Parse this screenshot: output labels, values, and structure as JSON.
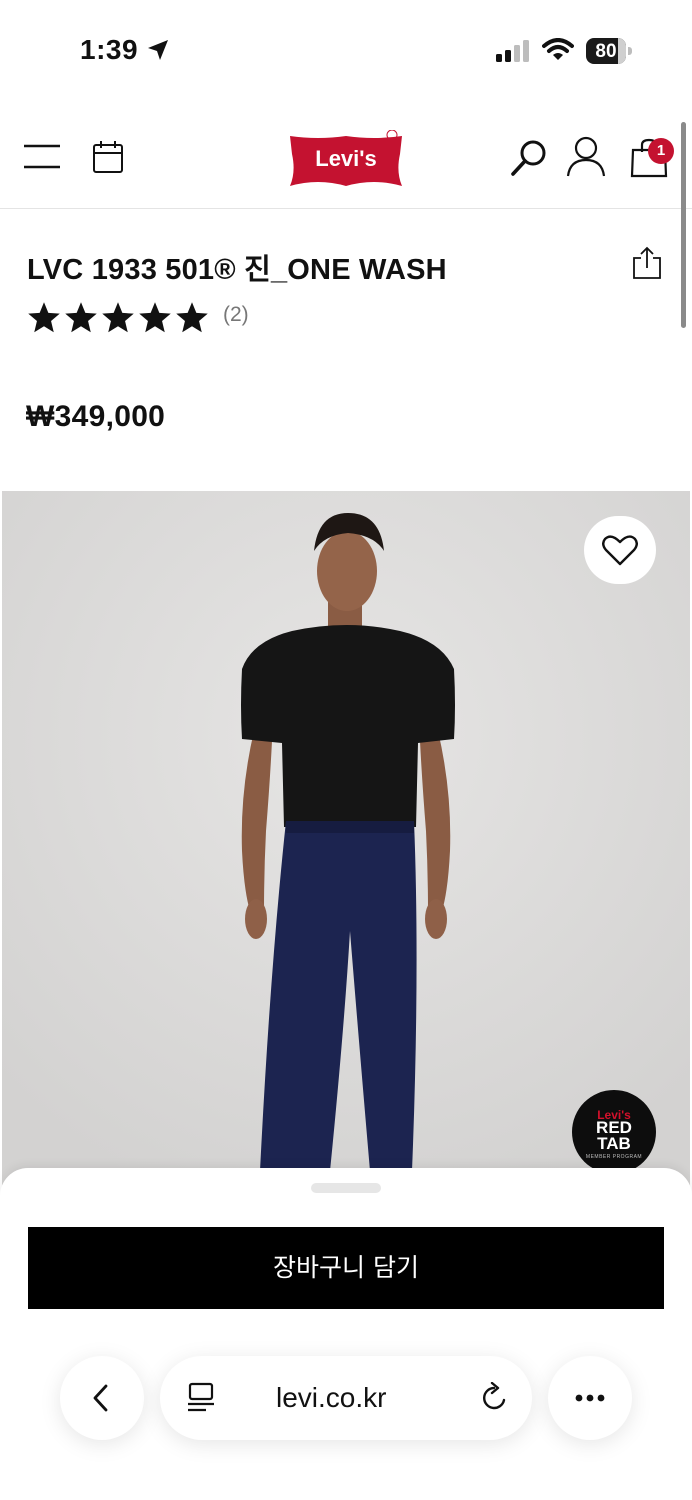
{
  "status_bar": {
    "time": "1:39",
    "battery": "80"
  },
  "header": {
    "logo_text": "Levi's",
    "cart_count": "1",
    "brand_color": "#c41230"
  },
  "product": {
    "title": "LVC 1933 501® 진_ONE WASH",
    "rating_stars": 5,
    "review_count": "(2)",
    "price": "₩349,000"
  },
  "image_badge": {
    "line1": "Levi's",
    "line2": "RED",
    "line3": "TAB",
    "line4": "MEMBER PROGRAM"
  },
  "cta": {
    "add_to_cart_label": "장바구니 담기"
  },
  "browser": {
    "url": "levi.co.kr"
  },
  "icons": [
    "menu-icon",
    "calendar-icon",
    "search-icon",
    "account-icon",
    "bag-icon",
    "share-icon",
    "heart-icon",
    "back-icon",
    "reader-icon",
    "reload-icon",
    "more-icon"
  ]
}
